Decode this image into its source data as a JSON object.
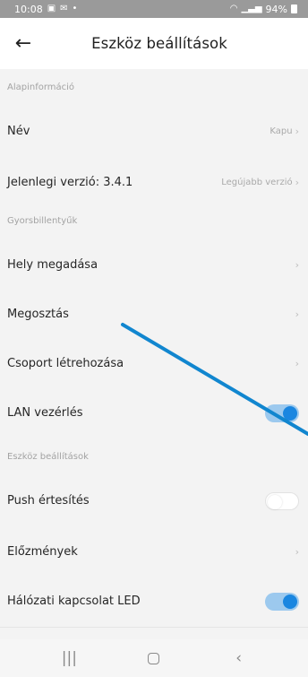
{
  "status_bar": {
    "time": "10:08",
    "left_icons": [
      "gallery-icon",
      "mail-icon",
      "bulb-icon"
    ],
    "battery": "94%"
  },
  "header": {
    "title": "Eszköz beállítások"
  },
  "sections": {
    "basic": "Alapinformáció",
    "shortcuts": "Gyorsbillentyűk",
    "device": "Eszköz beállítások"
  },
  "rows": {
    "name": {
      "label": "Név",
      "value": "Kapu"
    },
    "version": {
      "label": "Jelenlegi verzió: 3.4.1",
      "value": "Legújabb verzió"
    },
    "location": {
      "label": "Hely megadása"
    },
    "share": {
      "label": "Megosztás"
    },
    "group": {
      "label": "Csoport létrehozása"
    },
    "lan": {
      "label": "LAN vezérlés",
      "enabled": true
    },
    "push": {
      "label": "Push értesítés",
      "enabled": false
    },
    "history": {
      "label": "Előzmények"
    },
    "led": {
      "label": "Hálózati kapcsolat LED",
      "enabled": true
    }
  },
  "colors": {
    "accent": "#1a86e0",
    "toggle_track_on": "#9cc9ee",
    "arrow_annotation": "#1186cf"
  }
}
